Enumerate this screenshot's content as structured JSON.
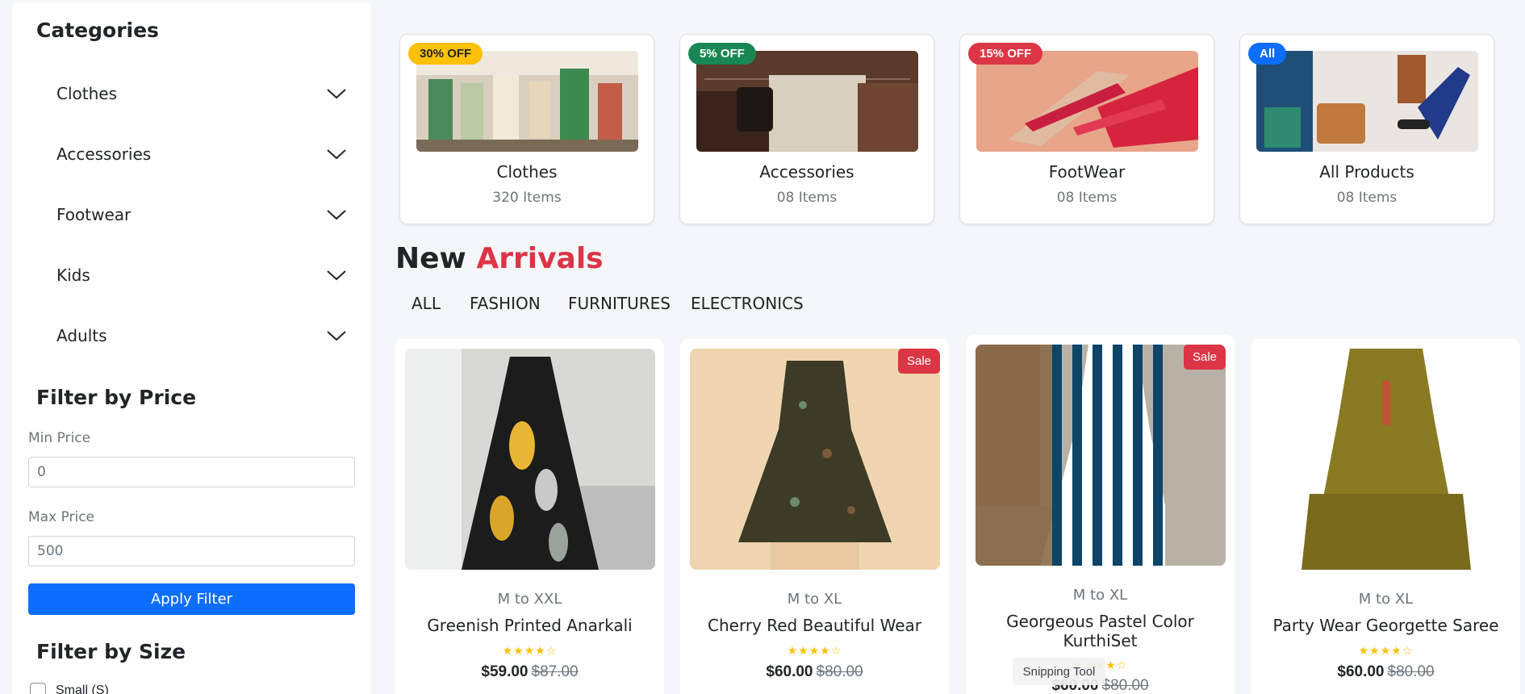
{
  "sidebar": {
    "categories_heading": "Categories",
    "categories": [
      {
        "label": "Clothes"
      },
      {
        "label": "Accessories"
      },
      {
        "label": "Footwear"
      },
      {
        "label": "Kids"
      },
      {
        "label": "Adults"
      }
    ],
    "price_heading": "Filter by Price",
    "min_label": "Min Price",
    "min_value": "0",
    "max_label": "Max Price",
    "max_value": "500",
    "apply_label": "Apply Filter",
    "size_heading": "Filter by Size",
    "size_options": [
      {
        "label": "Small (S)",
        "checked": false
      }
    ]
  },
  "category_cards": [
    {
      "badge": "30% OFF",
      "badge_bg": "#ffc107",
      "badge_fg": "#212529",
      "name": "Clothes",
      "count": "320 Items",
      "image": "clothing-store-image"
    },
    {
      "badge": "5% OFF",
      "badge_bg": "#198754",
      "badge_fg": "#ffffff",
      "name": "Accessories",
      "count": "08 Items",
      "image": "handbag-image"
    },
    {
      "badge": "15% OFF",
      "badge_bg": "#dc3545",
      "badge_fg": "#ffffff",
      "name": "FootWear",
      "count": "08 Items",
      "image": "sandals-image"
    },
    {
      "badge": "All",
      "badge_bg": "#0d6efd",
      "badge_fg": "#ffffff",
      "name": "All Products",
      "count": "08 Items",
      "image": "flatlay-products-image"
    }
  ],
  "arrivals": {
    "title_word1": "New",
    "title_word2": "Arrivals",
    "tabs": [
      "ALL",
      "FASHION",
      "FURNITURES",
      "ELECTRONICS"
    ]
  },
  "products": [
    {
      "size": "M to XXL",
      "name": "Greenish Printed Anarkali",
      "stars": "★★★★☆",
      "price": "$59.00",
      "old_price": "$87.00",
      "sale": "",
      "image": "floral-dress-image"
    },
    {
      "size": "M to XL",
      "name": "Cherry Red Beautiful Wear",
      "stars": "★★★★☆",
      "price": "$60.00",
      "old_price": "$80.00",
      "sale": "Sale",
      "image": "printed-dress-image"
    },
    {
      "size": "M to XL",
      "name": "Georgeous Pastel Color KurthiSet",
      "stars": "★★★★☆",
      "price": "$60.00",
      "old_price": "$80.00",
      "sale": "Sale",
      "image": "striped-dress-image"
    },
    {
      "size": "M to XL",
      "name": "Party Wear Georgette Saree",
      "stars": "★★★★☆",
      "price": "$60.00",
      "old_price": "$80.00",
      "sale": "",
      "image": "olive-dress-image"
    }
  ],
  "overlay": {
    "snipping_tool": "Snipping Tool"
  },
  "colors": {
    "accent_blue": "#0d6efd",
    "accent_red": "#dc3545",
    "star": "#ffc107"
  }
}
